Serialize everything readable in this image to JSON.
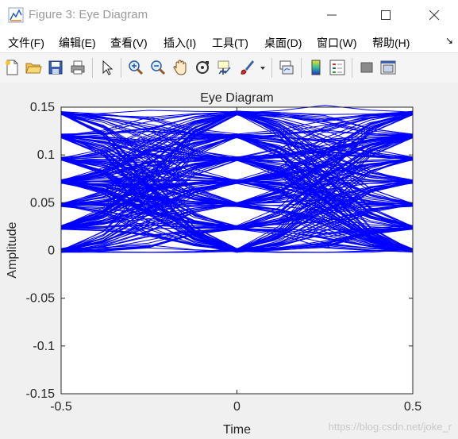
{
  "window": {
    "title": "Figure 3: Eye Diagram"
  },
  "menu": {
    "items": [
      "文件(F)",
      "编辑(E)",
      "查看(V)",
      "插入(I)",
      "工具(T)",
      "桌面(D)",
      "窗口(W)",
      "帮助(H)"
    ]
  },
  "toolbar": {
    "icons": [
      "new-figure-icon",
      "open-file-icon",
      "save-icon",
      "print-icon",
      "edit-plot-arrow-icon",
      "zoom-in-icon",
      "zoom-out-icon",
      "pan-hand-icon",
      "rotate-3d-icon",
      "data-cursor-icon",
      "brush-icon",
      "brush-dropdown-icon",
      "link-plot-icon",
      "colorbar-icon",
      "legend-icon",
      "hide-plot-tools-icon",
      "show-plot-tools-icon"
    ]
  },
  "colors": {
    "trace": "#0000ff",
    "axes_background": "#ffffff",
    "figure_background": "#f0f0f0"
  },
  "chart_data": {
    "type": "line",
    "title": "Eye Diagram",
    "xlabel": "Time",
    "ylabel": "Amplitude",
    "xlim": [
      -0.5,
      0.5
    ],
    "ylim": [
      -0.15,
      0.15
    ],
    "xticks": [
      "-0.5",
      "0",
      "0.5"
    ],
    "yticks": [
      "0.15",
      "0.1",
      "0.05",
      "0",
      "-0.05",
      "-0.1",
      "-0.15"
    ],
    "grid": false,
    "series": [
      {
        "levels": [
          0.0,
          0.024,
          0.048,
          0.072,
          0.096,
          0.12,
          0.144
        ],
        "color": "#0000ff"
      }
    ]
  },
  "watermark": "https://blog.csdn.net/joke_r"
}
